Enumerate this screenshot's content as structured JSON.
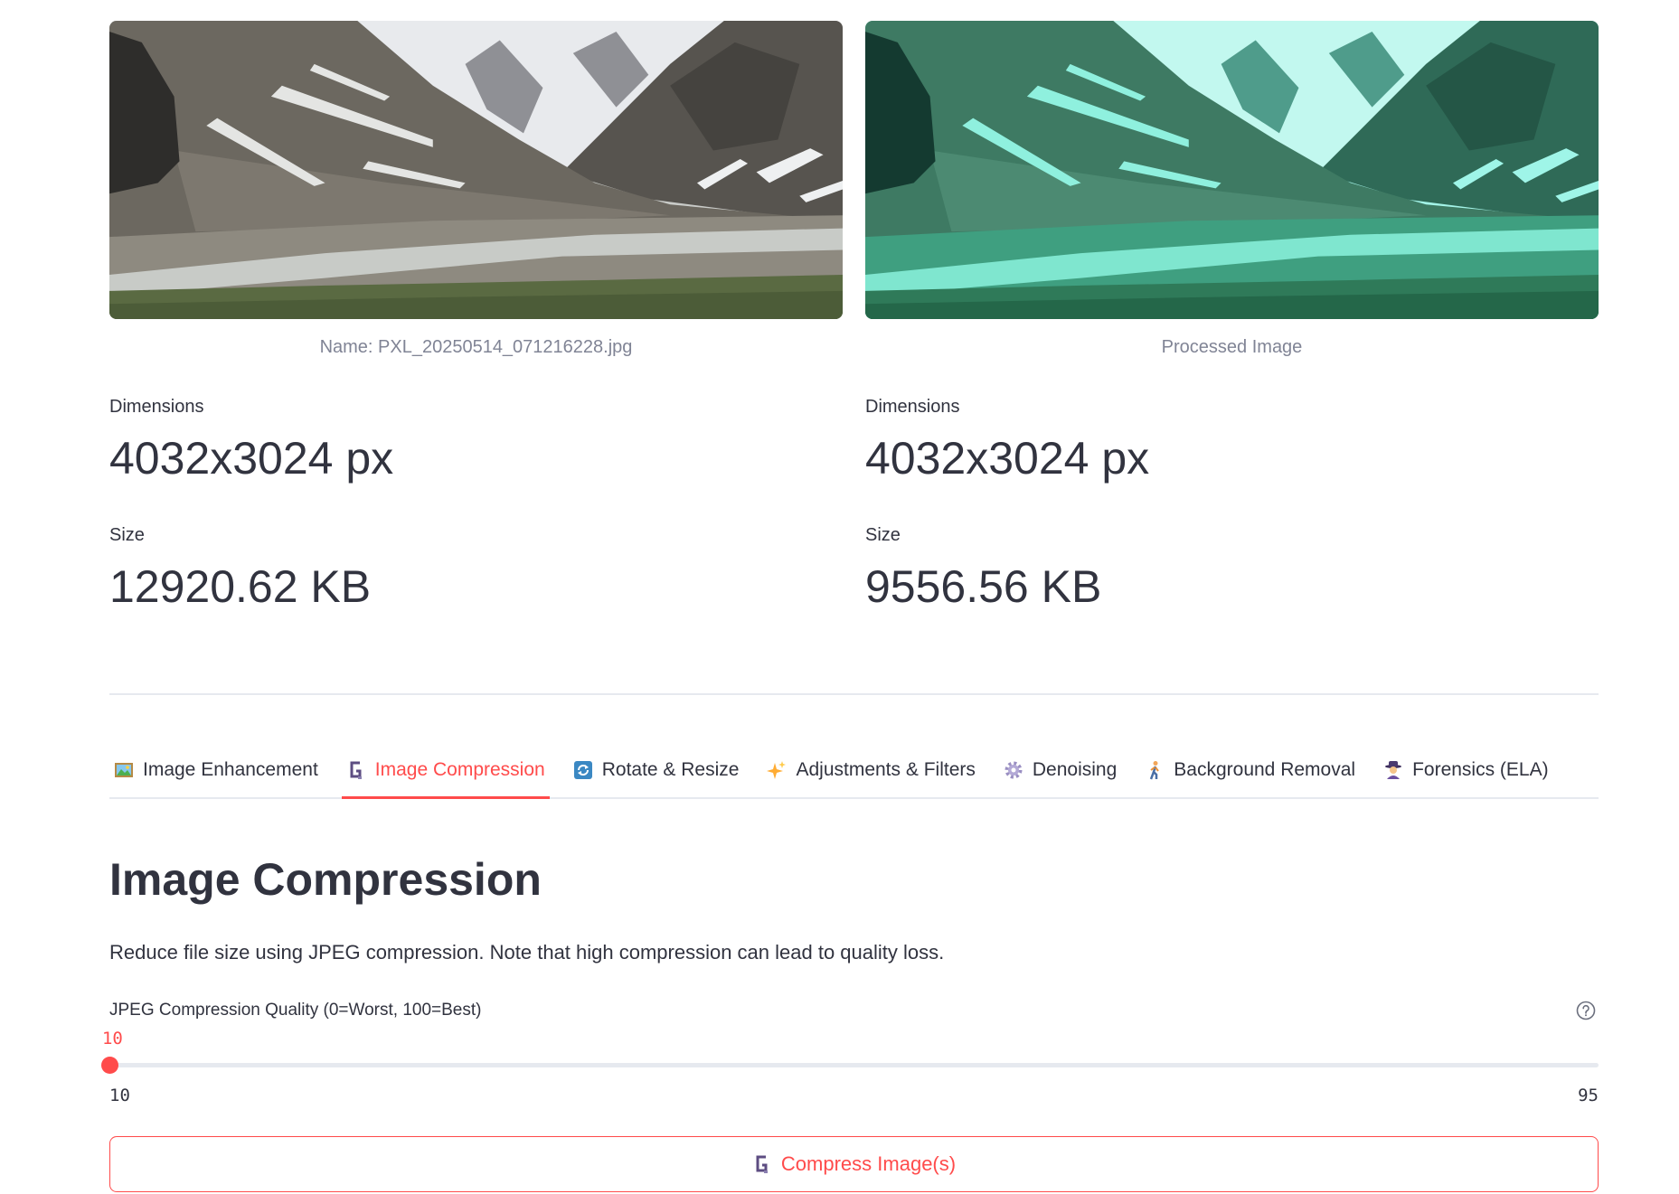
{
  "original": {
    "caption": "Name: PXL_20250514_071216228.jpg",
    "dimensions_label": "Dimensions",
    "dimensions_value": "4032x3024 px",
    "size_label": "Size",
    "size_value": "12920.62 KB"
  },
  "processed": {
    "caption": "Processed Image",
    "dimensions_label": "Dimensions",
    "dimensions_value": "4032x3024 px",
    "size_label": "Size",
    "size_value": "9556.56 KB"
  },
  "tabs": [
    {
      "label": "Image Enhancement",
      "icon": "framed-picture-icon",
      "active": false
    },
    {
      "label": "Image Compression",
      "icon": "clamp-icon",
      "active": true
    },
    {
      "label": "Rotate & Resize",
      "icon": "rotate-arrows-icon",
      "active": false
    },
    {
      "label": "Adjustments & Filters",
      "icon": "sparkles-icon",
      "active": false
    },
    {
      "label": "Denoising",
      "icon": "gear-icon",
      "active": false
    },
    {
      "label": "Background Removal",
      "icon": "walking-person-icon",
      "active": false
    },
    {
      "label": "Forensics (ELA)",
      "icon": "detective-icon",
      "active": false
    }
  ],
  "section": {
    "title": "Image Compression",
    "description": "Reduce file size using JPEG compression. Note that high compression can lead to quality loss."
  },
  "slider": {
    "label": "JPEG Compression Quality (0=Worst, 100=Best)",
    "value": 10,
    "min": 10,
    "max": 95,
    "help_icon": "question-circle-icon"
  },
  "compress_button": {
    "label": "Compress Image(s)",
    "icon": "clamp-icon"
  },
  "colors": {
    "accent": "#ff4b4b",
    "text": "#31333f",
    "muted": "#808495",
    "border": "#e6e9ef"
  }
}
